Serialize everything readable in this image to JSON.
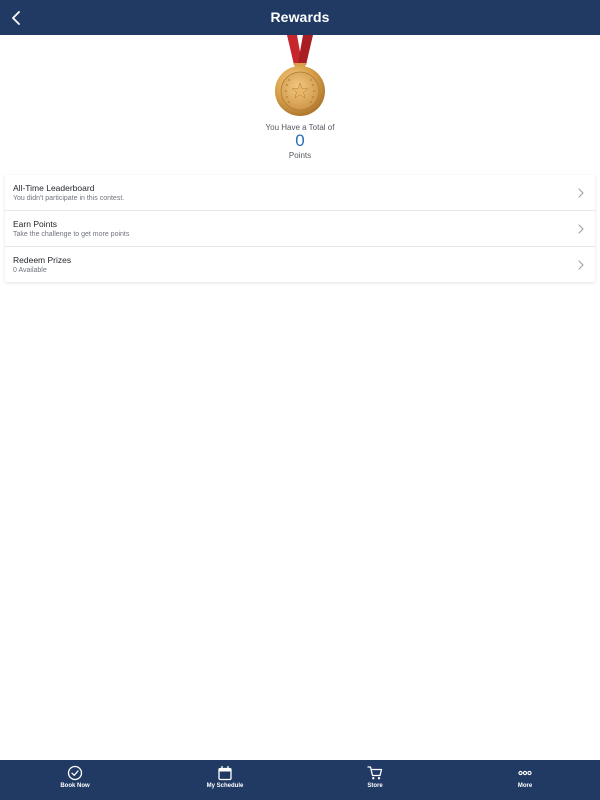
{
  "header": {
    "title": "Rewards",
    "background": "#213a64"
  },
  "summary": {
    "total_label": "You Have a Total of",
    "points_value": "0",
    "points_label": "Points",
    "medal_icon": "gold-medal-icon"
  },
  "menu": {
    "items": [
      {
        "title": "All-Time Leaderboard",
        "subtitle": "You didn't participate in this contest."
      },
      {
        "title": "Earn Points",
        "subtitle": "Take the challenge to get more points"
      },
      {
        "title": "Redeem Prizes",
        "subtitle": "0 Available"
      }
    ]
  },
  "tabbar": {
    "tabs": [
      {
        "label": "Book Now",
        "icon": "check-circle-icon"
      },
      {
        "label": "My Schedule",
        "icon": "calendar-icon"
      },
      {
        "label": "Store",
        "icon": "cart-icon"
      },
      {
        "label": "More",
        "icon": "more-dots-icon"
      }
    ]
  },
  "colors": {
    "accent": "#2a6db5",
    "medal_gold": "#d9a24a",
    "ribbon_red": "#c8262d"
  }
}
